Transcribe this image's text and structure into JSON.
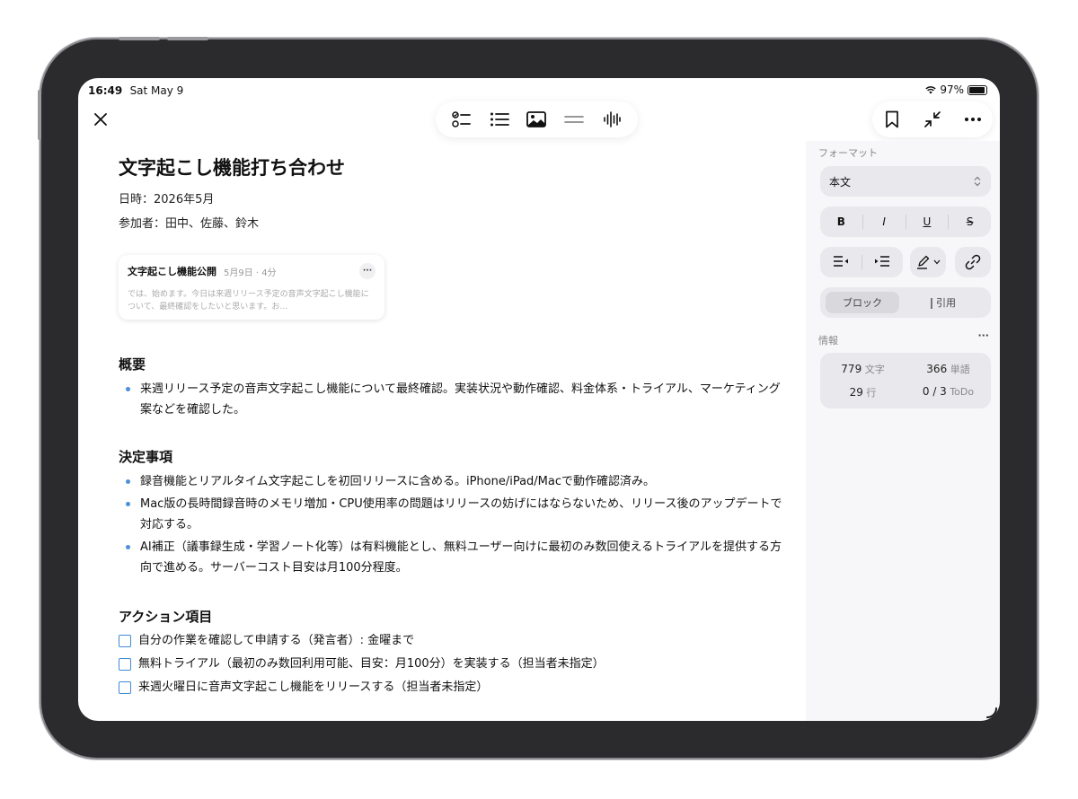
{
  "status": {
    "time": "16:49",
    "date": "Sat May 9",
    "battery": "97%",
    "battery_level": 0.97
  },
  "toolbar": {
    "left_icon": "close-icon",
    "center_icons": [
      "checklist-icon",
      "list-icon",
      "image-icon",
      "divider-icon",
      "waveform-icon"
    ],
    "right_icons": [
      "bookmark-icon",
      "collapse-icon",
      "more-icon"
    ]
  },
  "document": {
    "title": "文字起こし機能打ち合わせ",
    "date_line": "日時：2026年5月",
    "participants_line": "参加者：田中、佐藤、鈴木"
  },
  "recording_card": {
    "title": "文字起こし機能公開",
    "meta": "5月9日 · 4分",
    "more": "···",
    "preview": "では、始めます。今日は来週リリース予定の音声文字起こし機能について、最終確認をしたいと思います。お…"
  },
  "sections": {
    "overview": {
      "heading": "概要",
      "items": [
        "来週リリース予定の音声文字起こし機能について最終確認。実装状況や動作確認、料金体系・トライアル、マーケティング案などを確認した。"
      ]
    },
    "decisions": {
      "heading": "決定事項",
      "items": [
        "録音機能とリアルタイム文字起こしを初回リリースに含める。iPhone/iPad/Macで動作確認済み。",
        "Mac版の長時間録音時のメモリ増加・CPU使用率の問題はリリースの妨げにはならないため、リリース後のアップデートで対応する。",
        "AI補正（議事録生成・学習ノート化等）は有料機能とし、無料ユーザー向けに最初のみ数回使えるトライアルを提供する方向で進める。サーバーコスト目安は月100分程度。"
      ]
    },
    "actions": {
      "heading": "アクション項目",
      "items": [
        "自分の作業を確認して申請する（発言者）: 金曜まで",
        "無料トライアル（最初のみ数回利用可能、目安：月100分）を実装する（担当者未指定）",
        "来週火曜日に音声文字起こし機能をリリースする（担当者未指定）"
      ]
    }
  },
  "sidebar": {
    "format_label": "フォーマット",
    "style_select": "本文",
    "text_styles": [
      "B",
      "I",
      "U",
      "S"
    ],
    "block_label": "ブロック",
    "quote_label": "引用",
    "info_label": "情報",
    "info_more": "···",
    "stats": [
      {
        "num": "779",
        "unit": "文字"
      },
      {
        "num": "366",
        "unit": "単語"
      },
      {
        "num": "29",
        "unit": "行"
      },
      {
        "num": "0 / 3",
        "unit": "ToDo"
      }
    ]
  }
}
